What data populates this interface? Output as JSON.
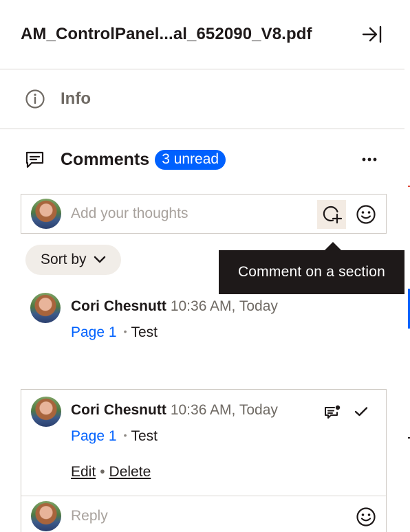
{
  "header": {
    "title": "AM_ControlPanel...al_652090_V8.pdf",
    "collapse_icon": "collapse-right-icon"
  },
  "info": {
    "label": "Info",
    "icon": "info-icon"
  },
  "comments": {
    "label": "Comments",
    "unread_badge": "3 unread",
    "more_icon": "more-horizontal-icon",
    "input_placeholder": "Add your thoughts",
    "tooltip": "Comment on a section",
    "sort_label": "Sort by",
    "list": [
      {
        "author": "Cori Chesnutt",
        "time": "10:36 AM, Today",
        "page": "Page 1",
        "separator": "•",
        "text": "Test"
      },
      {
        "author": "Cori Chesnutt",
        "time": "10:36 AM, Today",
        "page": "Page 1",
        "separator": "•",
        "text": "Test",
        "edit_label": "Edit",
        "action_separator": "•",
        "delete_label": "Delete",
        "reply_placeholder": "Reply"
      }
    ]
  },
  "colors": {
    "accent": "#0061fe",
    "text": "#1e1919",
    "muted": "#6f6a64",
    "tooltip_bg": "#1e1919"
  }
}
